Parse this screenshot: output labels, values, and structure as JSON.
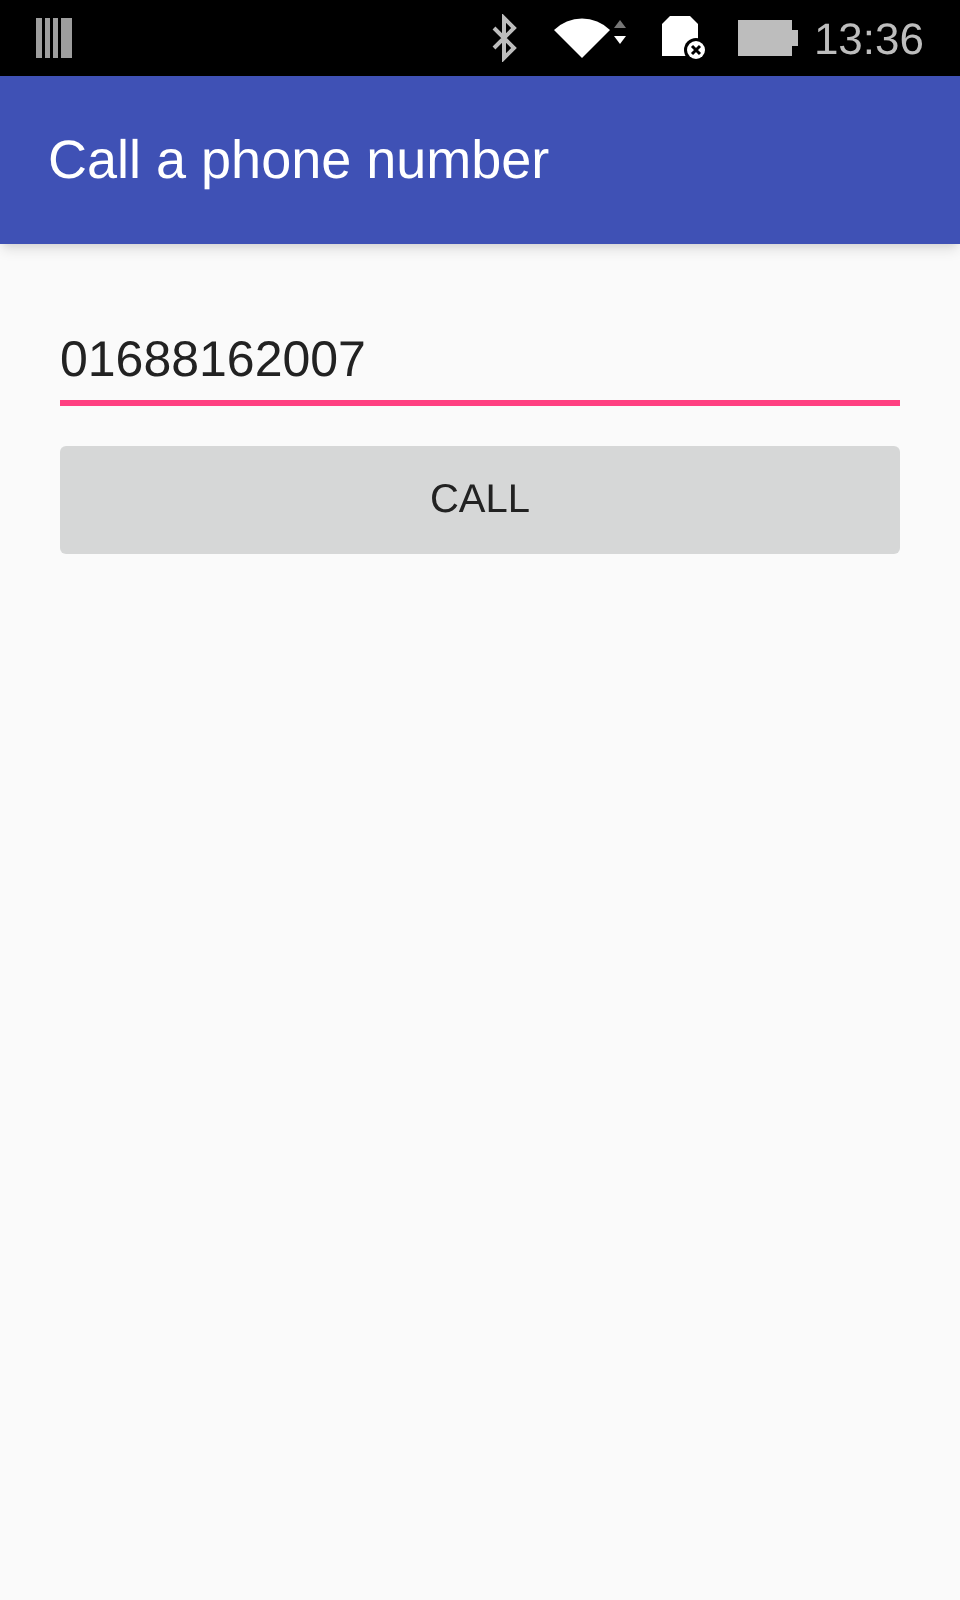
{
  "status_bar": {
    "time": "13:36"
  },
  "app_bar": {
    "title": "Call a phone number"
  },
  "phone_field": {
    "value": "01688162007"
  },
  "call_button": {
    "label": "CALL"
  }
}
